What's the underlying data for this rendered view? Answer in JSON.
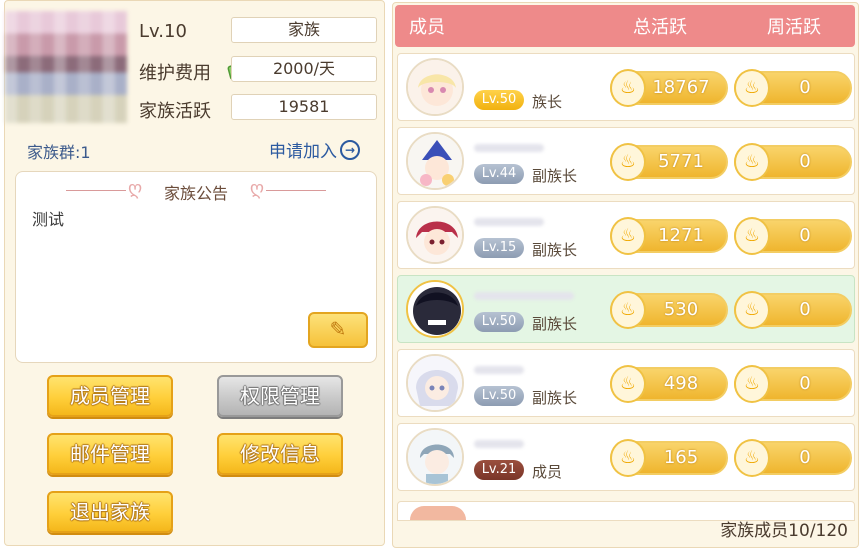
{
  "family": {
    "level": "Lv.10",
    "name": "家族",
    "maintenance_label": "维护费用",
    "maintenance_value": "2000/天",
    "activity_label": "家族活跃",
    "activity_value": "19581",
    "group_label": "家族群:1",
    "join_label": "申请加入"
  },
  "notice": {
    "title": "家族公告",
    "text": "测试"
  },
  "buttons": {
    "member_manage": "成员管理",
    "permission_manage": "权限管理",
    "mail_manage": "邮件管理",
    "edit_info": "修改信息",
    "leave_family": "退出家族"
  },
  "members_header": {
    "member": "成员",
    "total_activity": "总活跃",
    "weekly_activity": "周活跃"
  },
  "members": [
    {
      "level": "Lv.50",
      "role": "族长",
      "total": "18767",
      "weekly": "0",
      "badge": "gold"
    },
    {
      "level": "Lv.44",
      "role": "副族长",
      "total": "5771",
      "weekly": "0",
      "badge": "silver"
    },
    {
      "level": "Lv.15",
      "role": "副族长",
      "total": "1271",
      "weekly": "0",
      "badge": "silver"
    },
    {
      "level": "Lv.50",
      "role": "副族长",
      "total": "530",
      "weekly": "0",
      "badge": "silver"
    },
    {
      "level": "Lv.50",
      "role": "副族长",
      "total": "498",
      "weekly": "0",
      "badge": "silver"
    },
    {
      "level": "Lv.21",
      "role": "成员",
      "total": "165",
      "weekly": "0",
      "badge": "brown"
    }
  ],
  "footer": {
    "member_count": "家族成员10/120"
  },
  "icons": {
    "money": "money-icon",
    "fire": "fire-icon",
    "pencil": "pencil-icon",
    "flame": "flame-icon"
  },
  "colors": {
    "header": "#ee8a8a",
    "button_yellow": "#ffcf3a",
    "button_gray": "#c9c9c9",
    "highlight_row": "#e4f6e4",
    "link": "#2c5aa0"
  }
}
